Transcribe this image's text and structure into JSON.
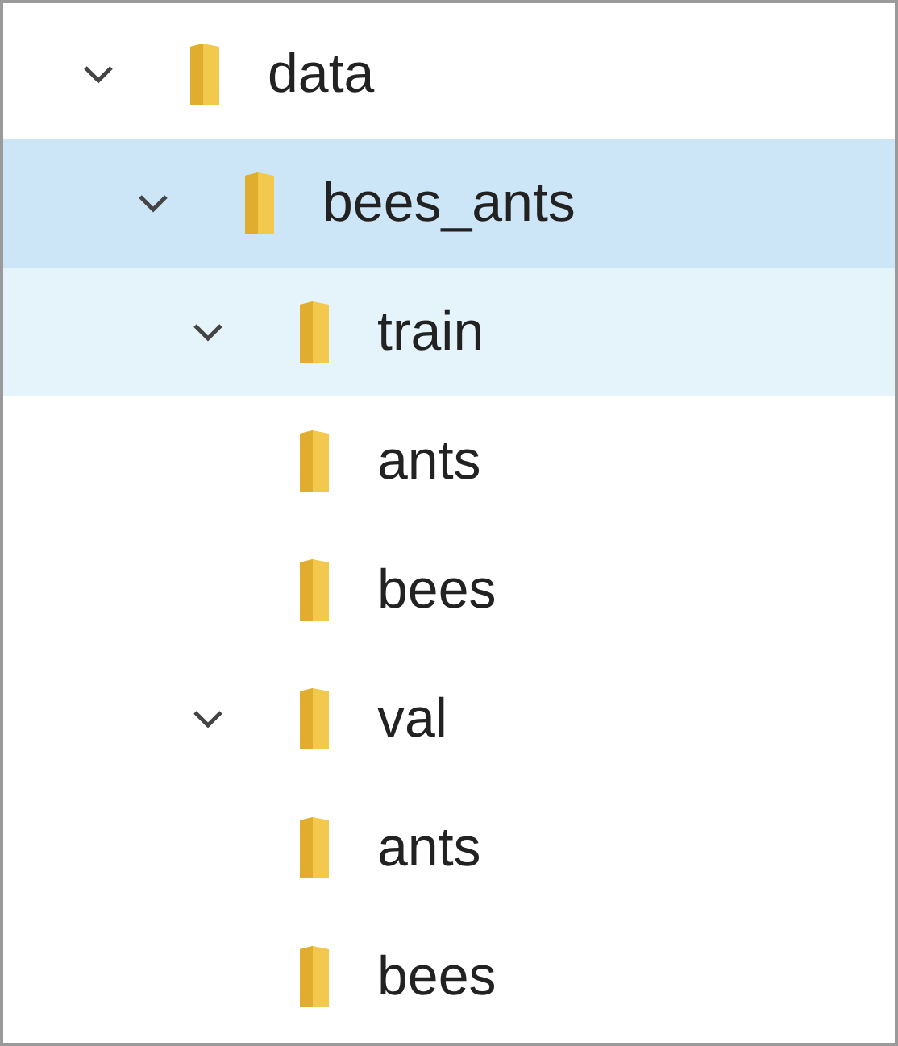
{
  "tree": [
    {
      "label": "data",
      "expanded": true,
      "selected": false,
      "hovered": false,
      "children": [
        {
          "label": "bees_ants",
          "expanded": true,
          "selected": true,
          "hovered": false,
          "children": [
            {
              "label": "train",
              "expanded": true,
              "selected": false,
              "hovered": true,
              "children": [
                {
                  "label": "ants",
                  "selected": false,
                  "hovered": false
                },
                {
                  "label": "bees",
                  "selected": false,
                  "hovered": false
                }
              ]
            },
            {
              "label": "val",
              "expanded": true,
              "selected": false,
              "hovered": false,
              "children": [
                {
                  "label": "ants",
                  "selected": false,
                  "hovered": false
                },
                {
                  "label": "bees",
                  "selected": false,
                  "hovered": false
                }
              ]
            }
          ]
        }
      ]
    }
  ]
}
